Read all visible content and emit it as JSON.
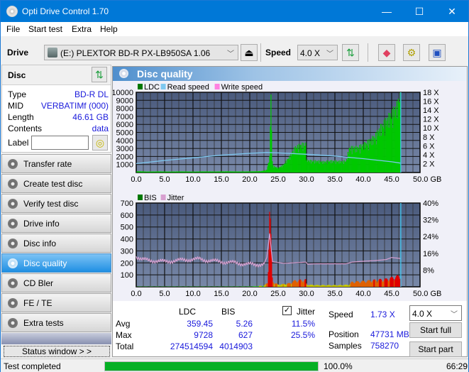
{
  "window": {
    "title": "Opti Drive Control 1.70",
    "controls": {
      "minimize": "—",
      "maximize": "☐",
      "close": "✕"
    }
  },
  "menu": [
    {
      "label": "File",
      "accel": "F"
    },
    {
      "label": "Start test",
      "accel": "S"
    },
    {
      "label": "Extra",
      "accel": "x"
    },
    {
      "label": "Help",
      "accel": "H"
    }
  ],
  "toolbar": {
    "drive_label": "Drive",
    "drive_value": "(E:)  PLEXTOR BD-R  PX-LB950SA 1.06",
    "speed_label": "Speed",
    "speed_value": "4.0 X",
    "icons": [
      "eject-icon",
      "refresh-icon",
      "erase-icon",
      "settings-icon",
      "save-icon"
    ]
  },
  "disc": {
    "title": "Disc",
    "rows": [
      {
        "key": "Type",
        "value": "BD-R DL"
      },
      {
        "key": "MID",
        "value": "VERBATIMf (000)"
      },
      {
        "key": "Length",
        "value": "46.61 GB"
      },
      {
        "key": "Contents",
        "value": "data"
      }
    ],
    "label_key": "Label",
    "label_value": ""
  },
  "nav": [
    {
      "label": "Transfer rate",
      "active": false
    },
    {
      "label": "Create test disc",
      "active": false
    },
    {
      "label": "Verify test disc",
      "active": false
    },
    {
      "label": "Drive info",
      "active": false
    },
    {
      "label": "Disc info",
      "active": false
    },
    {
      "label": "Disc quality",
      "active": true
    },
    {
      "label": "CD Bler",
      "active": false
    },
    {
      "label": "FE / TE",
      "active": false
    },
    {
      "label": "Extra tests",
      "active": false
    }
  ],
  "status_window_label": "Status window > >",
  "panel_title": "Disc quality",
  "colors": {
    "ldc": "#00c800",
    "read_speed": "#7ec8f0",
    "write_speed": "#ff80e0",
    "bis_legend": "#007800",
    "jitter": "#d8a0d0",
    "plot_bg_top": "#4a5a7c",
    "plot_bg_bottom": "#7888a8",
    "marker": "#40c8f0",
    "bis_red": "#e00000",
    "bis_yellow": "#c8c800",
    "progress": "#06b025",
    "value_text": "#1a1adb"
  },
  "chart_data": [
    {
      "type": "area",
      "title": "LDC / Read speed",
      "legend": [
        "LDC",
        "Read speed",
        "Write speed"
      ],
      "legend_placement": "top-left",
      "xlabel": "GB",
      "xlim": [
        0,
        50
      ],
      "x_ticks": [
        "0.0",
        "5.0",
        "10.0",
        "15.0",
        "20.0",
        "25.0",
        "30.0",
        "35.0",
        "40.0",
        "45.0",
        "50.0 GB"
      ],
      "ylim_left": [
        0,
        10000
      ],
      "y_ticks_left": [
        "1000",
        "2000",
        "3000",
        "4000",
        "5000",
        "6000",
        "7000",
        "8000",
        "9000",
        "10000"
      ],
      "ylim_right": [
        0,
        18
      ],
      "y_ticks_right": [
        "2 X",
        "4 X",
        "6 X",
        "8 X",
        "10 X",
        "12 X",
        "14 X",
        "16 X",
        "18 X"
      ],
      "grid": true,
      "marker_x": 46.61,
      "series": [
        {
          "name": "LDC",
          "x": [
            0,
            2,
            4,
            6,
            8,
            10,
            12,
            14,
            16,
            18,
            20,
            22,
            23.0,
            23.5,
            23.7,
            24,
            25,
            26,
            27,
            28,
            29,
            29.9,
            30.0,
            31,
            32,
            33,
            34,
            35,
            36,
            37,
            37.5,
            38,
            39,
            40,
            41,
            42,
            43,
            44,
            45,
            46,
            46.6
          ],
          "values": [
            150,
            100,
            120,
            100,
            120,
            100,
            120,
            110,
            130,
            110,
            120,
            150,
            300,
            1700,
            9700,
            800,
            500,
            900,
            1800,
            2800,
            3100,
            3200,
            1400,
            1300,
            1300,
            1200,
            1300,
            1300,
            1250,
            1300,
            2700,
            2800,
            2800,
            3100,
            3500,
            4000,
            5000,
            5800,
            6600,
            7500,
            9000
          ]
        },
        {
          "name": "Read speed",
          "x": [
            0,
            5,
            10,
            15,
            20,
            23,
            25,
            30,
            35,
            40,
            45,
            46.6
          ],
          "values": [
            2.0,
            2.7,
            3.3,
            3.9,
            4.3,
            4.5,
            4.4,
            4.1,
            3.7,
            3.1,
            2.4,
            2.1
          ]
        },
        {
          "name": "Write speed",
          "x": [],
          "values": []
        }
      ]
    },
    {
      "type": "area",
      "title": "BIS / Jitter",
      "legend": [
        "BIS",
        "Jitter"
      ],
      "legend_placement": "top-left",
      "xlabel": "GB",
      "xlim": [
        0,
        50
      ],
      "x_ticks": [
        "0.0",
        "5.0",
        "10.0",
        "15.0",
        "20.0",
        "25.0",
        "30.0",
        "35.0",
        "40.0",
        "45.0",
        "50.0 GB"
      ],
      "ylim_left": [
        0,
        700
      ],
      "y_ticks_left": [
        "100",
        "200",
        "300",
        "400",
        "500",
        "600",
        "700"
      ],
      "ylim_right": [
        0,
        40
      ],
      "y_ticks_right": [
        "8%",
        "16%",
        "24%",
        "32%",
        "40%"
      ],
      "grid": true,
      "marker_x": 46.61,
      "series": [
        {
          "name": "BIS",
          "x": [
            0,
            5,
            10,
            15,
            20,
            22.5,
            23.2,
            23.5,
            24,
            25,
            27,
            28,
            29.9,
            30,
            32,
            34,
            36,
            37.5,
            38,
            40,
            42,
            44,
            45,
            46,
            46.6
          ],
          "values": [
            2,
            2,
            2,
            2,
            3,
            8,
            30,
            627,
            40,
            15,
            25,
            45,
            50,
            15,
            12,
            12,
            12,
            15,
            35,
            40,
            48,
            55,
            65,
            75,
            85
          ]
        },
        {
          "name": "Jitter",
          "x": [
            0,
            1,
            3,
            5,
            7,
            9,
            11,
            13,
            15,
            17,
            19,
            21,
            22.5,
            23,
            23.5,
            24,
            26,
            28,
            29.9,
            30.2,
            32,
            35,
            37,
            38,
            40,
            42,
            44,
            45,
            46.6
          ],
          "values": [
            14.5,
            13,
            12.5,
            12,
            12.5,
            13,
            13.2,
            12.5,
            12,
            11.5,
            11,
            10.5,
            11,
            14,
            25.5,
            12,
            11.2,
            11.5,
            11.8,
            10.8,
            11,
            11,
            11,
            11.8,
            12.2,
            12.5,
            13,
            14,
            13.5
          ]
        }
      ]
    }
  ],
  "stats": {
    "col_ldc": "LDC",
    "col_bis": "BIS",
    "jitter_checked": true,
    "jitter_label": "Jitter",
    "rows": [
      {
        "label": "Avg",
        "ldc": "359.45",
        "bis": "5.26",
        "jitter": "11.5%"
      },
      {
        "label": "Max",
        "ldc": "9728",
        "bis": "627",
        "jitter": "25.5%"
      },
      {
        "label": "Total",
        "ldc": "274514594",
        "bis": "4014903",
        "jitter": ""
      }
    ],
    "speed_label": "Speed",
    "speed_value": "1.73 X",
    "position_label": "Position",
    "position_value": "47731 MB",
    "samples_label": "Samples",
    "samples_value": "758270",
    "speed_select": "4.0 X",
    "start_full": "Start full",
    "start_part": "Start part"
  },
  "statusbar": {
    "text": "Test completed",
    "progress_percent": 100.0,
    "progress_text": "100.0%",
    "time": "66:29"
  }
}
